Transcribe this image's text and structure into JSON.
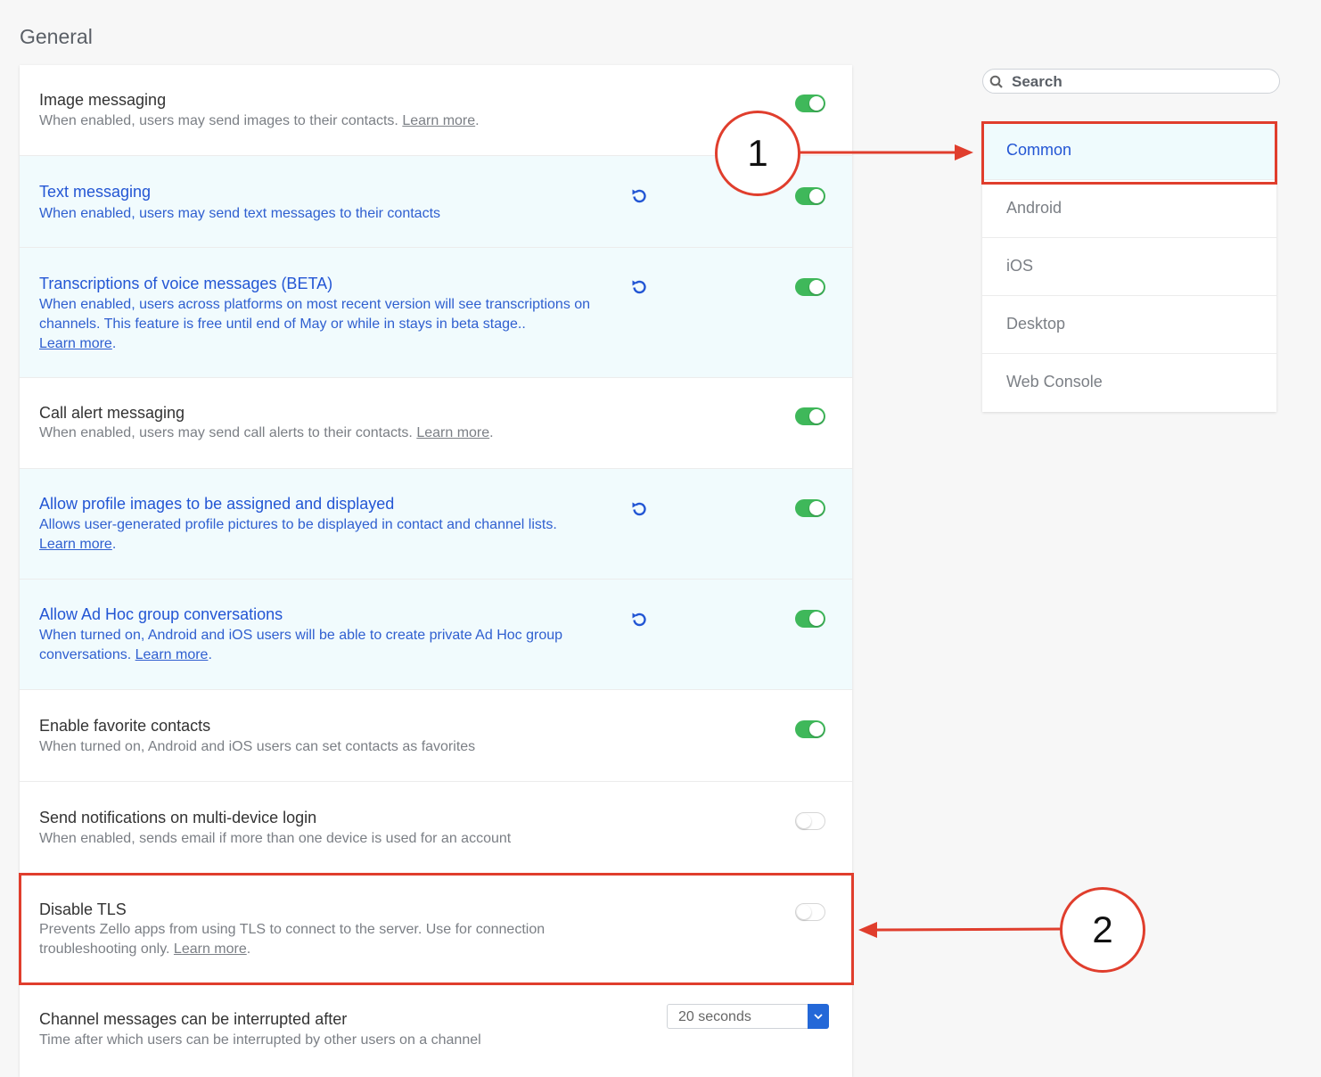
{
  "page": {
    "title": "General"
  },
  "search": {
    "placeholder": "Search"
  },
  "nav": {
    "items": [
      {
        "label": "Common",
        "active": true
      },
      {
        "label": "Android"
      },
      {
        "label": "iOS"
      },
      {
        "label": "Desktop"
      },
      {
        "label": "Web Console"
      }
    ]
  },
  "settings": {
    "learn_more": "Learn more",
    "rows": [
      {
        "title": "Image messaging",
        "desc": "When enabled, users may send images to their contacts.",
        "toggle": "on",
        "changed": false
      },
      {
        "title": "Text messaging",
        "desc": "When enabled, users may send text messages to their contacts",
        "toggle": "on",
        "changed": true
      },
      {
        "title": "Transcriptions of voice messages (BETA)",
        "desc": "When enabled, users across platforms on most recent version will see transcriptions on channels. This feature is free until end of May or while in stays in beta stage..",
        "toggle": "on",
        "changed": true
      },
      {
        "title": "Call alert messaging",
        "desc": "When enabled, users may send call alerts to their contacts.",
        "toggle": "on",
        "changed": false
      },
      {
        "title": "Allow profile images to be assigned and displayed",
        "desc": "Allows user-generated profile pictures to be displayed in contact and channel lists.",
        "toggle": "on",
        "changed": true
      },
      {
        "title": "Allow Ad Hoc group conversations",
        "desc": "When turned on, Android and iOS users will be able to create private Ad Hoc group conversations.",
        "toggle": "on",
        "changed": true
      },
      {
        "title": "Enable favorite contacts",
        "desc": "When turned on, Android and iOS users can set contacts as favorites",
        "toggle": "on",
        "changed": false
      },
      {
        "title": "Send notifications on multi-device login",
        "desc": "When enabled, sends email if more than one device is used for an account",
        "toggle": "off",
        "changed": false
      },
      {
        "title": "Disable TLS",
        "desc": "Prevents Zello apps from using TLS to connect to the server. Use for connection troubleshooting only.",
        "toggle": "off",
        "changed": false
      },
      {
        "title": "Channel messages can be interrupted after",
        "desc": "Time after which users can be interrupted by other users on a channel",
        "select_value": "20 seconds",
        "changed": false
      }
    ]
  },
  "annotations": {
    "callout_1": "1",
    "callout_2": "2",
    "color": "#e03e2d"
  },
  "colors": {
    "toggle_on": "#3fb85a",
    "link_blue": "#2356d4",
    "changed_bg": "#f1fbfd"
  }
}
